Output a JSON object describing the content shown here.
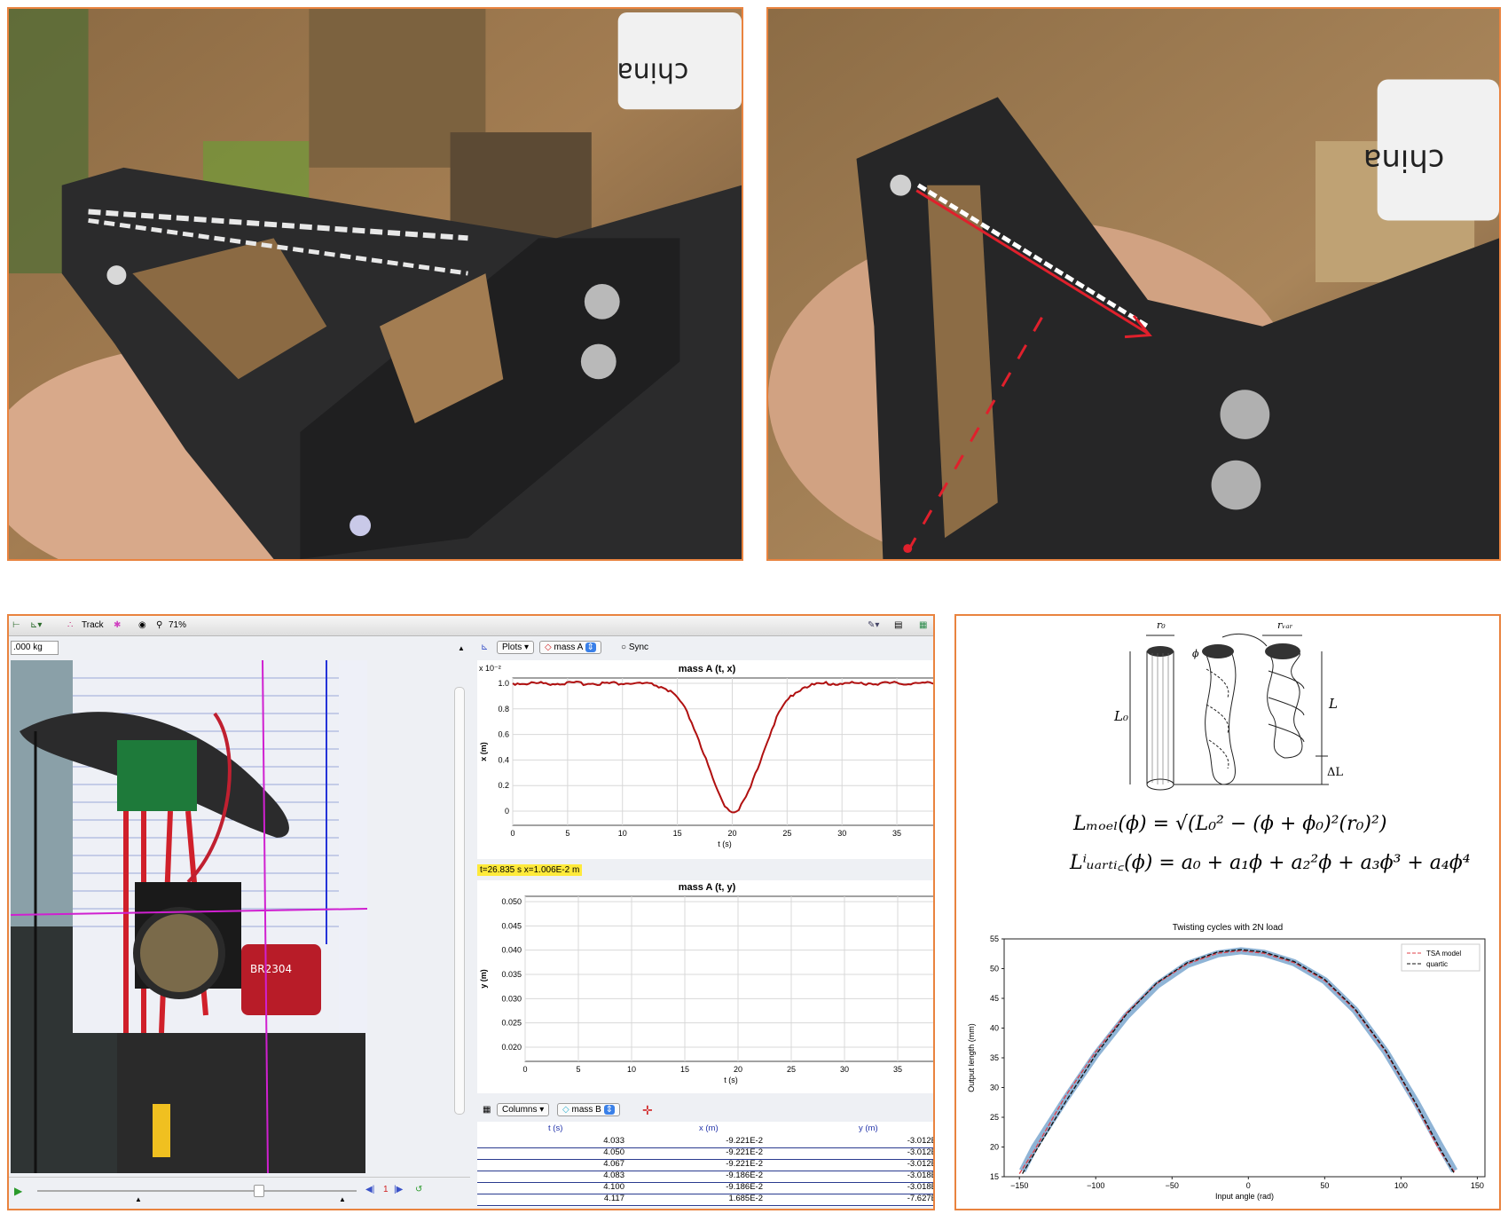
{
  "photo_left": {
    "label_text": "china"
  },
  "photo_right": {
    "label_text": "china"
  },
  "tracker": {
    "toolbar": {
      "track_label": "Track",
      "zoom": "71%"
    },
    "mass_value": ".000 kg",
    "video_label": "BR2304",
    "plots": {
      "plots_button": "Plots",
      "object": "mass A",
      "sync": "Sync"
    },
    "plot_x": {
      "title": "mass A (t, x)",
      "ylabel": "x (m)",
      "xlabel": "t (s)",
      "exponent": "x 10⁻²",
      "yticks": [
        "1.0",
        "0.8",
        "0.6",
        "0.4",
        "0.2",
        "0"
      ],
      "xticks": [
        "0",
        "5",
        "10",
        "15",
        "20",
        "25",
        "30",
        "35"
      ]
    },
    "readout": "t=26.835 s  x=1.006E-2 m",
    "plot_y": {
      "title": "mass A (t, y)",
      "ylabel": "y (m)",
      "xlabel": "t (s)",
      "yticks": [
        "0.050",
        "0.045",
        "0.040",
        "0.035",
        "0.030",
        "0.025",
        "0.020"
      ],
      "xticks": [
        "0",
        "5",
        "10",
        "15",
        "20",
        "25",
        "30",
        "35"
      ]
    },
    "columns": {
      "columns_button": "Columns",
      "object": "mass B"
    },
    "table": {
      "headers": [
        "t (s)",
        "x (m)",
        "y (m)"
      ],
      "rows": [
        [
          "4.033",
          "-9.221E-2",
          "-3.012E"
        ],
        [
          "4.050",
          "-9.221E-2",
          "-3.012E"
        ],
        [
          "4.067",
          "-9.221E-2",
          "-3.012E"
        ],
        [
          "4.083",
          "-9.186E-2",
          "-3.018E"
        ],
        [
          "4.100",
          "-9.186E-2",
          "-3.018E"
        ],
        [
          "4.117",
          "1.685E-2",
          "-7.627E"
        ]
      ]
    },
    "frame_number": "1"
  },
  "model": {
    "labels": {
      "r0": "r₀",
      "rvar": "rᵥₐᵣ",
      "L0": "L₀",
      "L": "L",
      "dL": "ΔL",
      "phi": "ϕ"
    },
    "eq1": "Lₘₒₑₗ(ϕ) = √(L₀² − (ϕ + ϕ₀)²(r₀)²)",
    "eq2": "Lⁱᵤₐᵣₜᵢ꜀(ϕ) = a₀ + a₁ϕ + a₂²ϕ + a₃ϕ³ + a₄ϕ⁴"
  },
  "chart_data": {
    "type": "line",
    "title": "Twisting cycles with 2N load",
    "xlabel": "Input angle (rad)",
    "ylabel": "Output length (mm)",
    "xlim": [
      -160,
      155
    ],
    "ylim": [
      15,
      55
    ],
    "xticks": [
      -150,
      -100,
      -50,
      0,
      50,
      100,
      150
    ],
    "yticks": [
      15,
      20,
      25,
      30,
      35,
      40,
      45,
      50,
      55
    ],
    "legend": "top-right",
    "series": [
      {
        "name": "TSA model",
        "color": "#e0404a",
        "style": "dashed",
        "x": [
          -150,
          -140,
          -120,
          -100,
          -80,
          -60,
          -40,
          -20,
          -5,
          10,
          30,
          50,
          70,
          90,
          110,
          125,
          135
        ],
        "y": [
          15.5,
          19.5,
          28.5,
          36,
          42.5,
          47.5,
          50.8,
          52.6,
          53,
          52.6,
          51,
          48,
          43,
          36,
          27,
          19.5,
          15.8
        ]
      },
      {
        "name": "quartic",
        "color": "#111111",
        "style": "dashed",
        "x": [
          -148,
          -140,
          -120,
          -100,
          -80,
          -60,
          -40,
          -20,
          -5,
          10,
          30,
          50,
          70,
          90,
          110,
          125,
          135
        ],
        "y": [
          15.5,
          19,
          27.5,
          35.5,
          42.3,
          47.6,
          51,
          52.8,
          53.2,
          52.8,
          51.2,
          48.2,
          43.2,
          36.2,
          27.2,
          20,
          15.5
        ]
      },
      {
        "name": "",
        "color": "#7ba7cf",
        "style": "thick",
        "x": [
          -148,
          -140,
          -120,
          -100,
          -80,
          -60,
          -40,
          -20,
          -5,
          10,
          30,
          50,
          70,
          90,
          110,
          125,
          135
        ],
        "y": [
          16,
          20,
          28,
          35.5,
          42,
          47.2,
          50.7,
          52.5,
          53,
          52.6,
          51,
          48,
          43,
          36,
          27.5,
          20.5,
          16
        ]
      }
    ]
  }
}
